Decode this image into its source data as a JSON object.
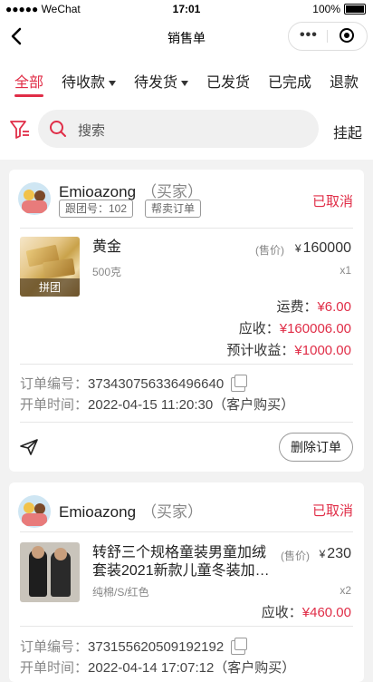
{
  "status_bar": {
    "carrier": "●●●●● WeChat",
    "time": "17:01",
    "battery": "100%"
  },
  "nav": {
    "title": "销售单"
  },
  "tabs": [
    {
      "label": "全部"
    },
    {
      "label": "待收款"
    },
    {
      "label": "待发货"
    },
    {
      "label": "已发货"
    },
    {
      "label": "已完成"
    },
    {
      "label": "退款"
    }
  ],
  "search": {
    "placeholder": "搜索",
    "hang_label": "挂起"
  },
  "orders": [
    {
      "buyer": "Emioazong",
      "role": "（买家）",
      "status": "已取消",
      "tags": [
        "跟团号：102",
        "帮卖订单"
      ],
      "product": {
        "name": "黄金",
        "spec": "500克",
        "price_label": "(售价)",
        "currency": "¥",
        "price": "160000",
        "qty": "x1",
        "badge": "拼团"
      },
      "fees": [
        {
          "label": "运费：",
          "value": "¥6.00"
        },
        {
          "label": "应收：",
          "value": "¥160006.00"
        },
        {
          "label": "预计收益：",
          "value": "¥1000.00"
        }
      ],
      "order_no_label": "订单编号：",
      "order_no": "373430756336496640",
      "open_time_label": "开单时间：",
      "open_time": "2022-04-15 11:20:30（客户购买）",
      "delete_label": "删除订单"
    },
    {
      "buyer": "Emioazong",
      "role": "（买家）",
      "status": "已取消",
      "product": {
        "name_line1": "转舒三个规格童装男童加绒",
        "name_line2": "套装2021新款儿童冬装加…",
        "spec": "纯棉/S/红色",
        "price_label": "(售价)",
        "currency": "¥",
        "price": "230",
        "qty": "x2"
      },
      "receivable_label": "应收：",
      "receivable": "¥460.00",
      "order_no_label": "订单编号：",
      "order_no": "373155620509192192",
      "open_time_label": "开单时间：",
      "open_time": "2022-04-14 17:07:12（客户购买）"
    }
  ],
  "colors": {
    "accent": "#e02d47",
    "background": "#f2f2f2"
  }
}
